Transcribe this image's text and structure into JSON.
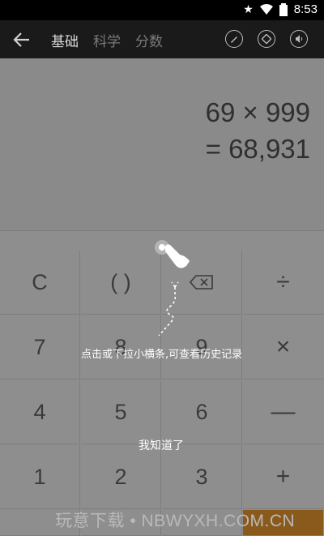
{
  "statusbar": {
    "time": "8:53",
    "icons": [
      "star-icon",
      "wifi-icon",
      "battery-icon"
    ]
  },
  "toolbar": {
    "tabs": [
      "基础",
      "科学",
      "分数"
    ],
    "active_tab": "基础",
    "icons": [
      "back-arrow-icon",
      "pencil-icon",
      "theme-icon",
      "sound-icon"
    ]
  },
  "display": {
    "expression": "69 × 999",
    "result": "= 68,931"
  },
  "keypad": {
    "rows": [
      [
        "C",
        "( )",
        "⌫",
        "÷"
      ],
      [
        "7",
        "8",
        "9",
        "×"
      ],
      [
        "4",
        "5",
        "6",
        "—"
      ],
      [
        "1",
        "2",
        "3",
        "+"
      ]
    ]
  },
  "overlay": {
    "tip": "点击或下拉小横条,可查看历史记录",
    "dismiss": "我知道了"
  },
  "watermark": "玩意下载 • NBWYXH.COM.CN",
  "colors": {
    "toolbar": "#1a1a1a",
    "statusbar": "#000000",
    "accent": "#8a5a1c"
  }
}
